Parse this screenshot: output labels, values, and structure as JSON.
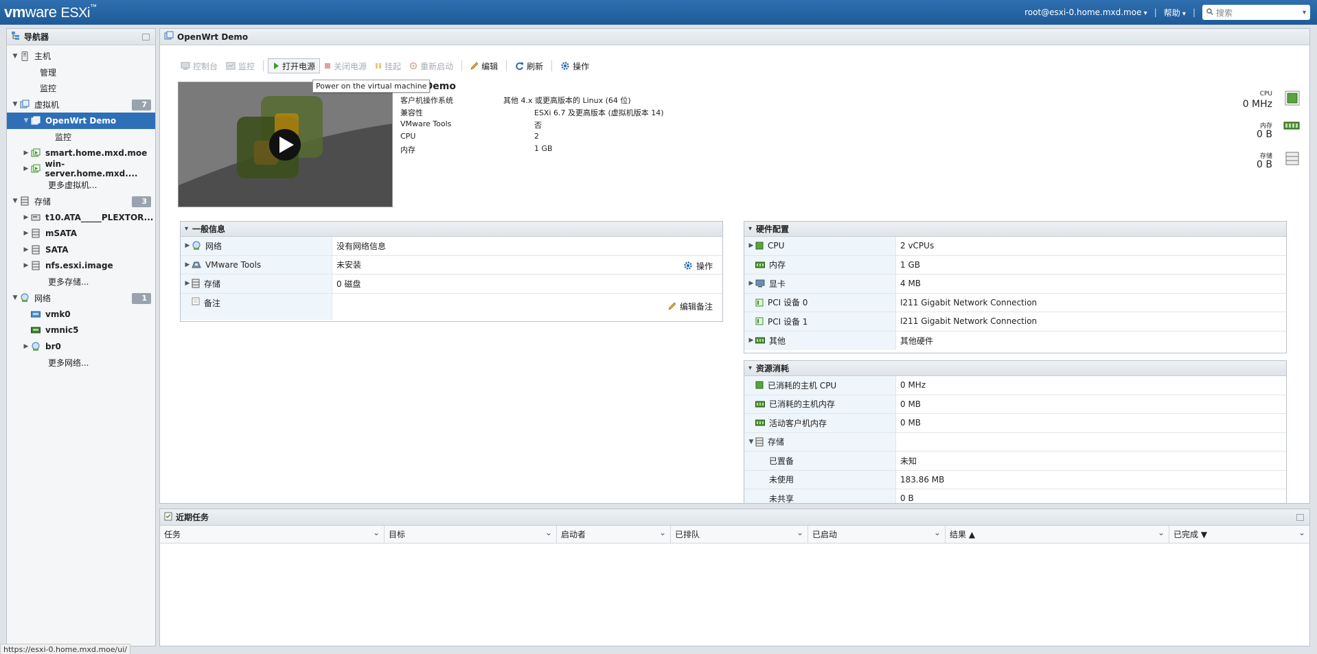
{
  "header": {
    "brand_vm": "vm",
    "brand_ware": "ware",
    "brand_esxi": "ESXi",
    "brand_tm": "™",
    "user": "root@esxi-0.home.mxd.moe",
    "help": "帮助",
    "search_placeholder": "搜索"
  },
  "navigator": {
    "title": "导航器",
    "host": {
      "label": "主机",
      "children": [
        "管理",
        "监控"
      ]
    },
    "vms": {
      "label": "虚拟机",
      "count": "7",
      "selected": "OpenWrt Demo",
      "selected_child": "监控",
      "items": [
        "smart.home.mxd.moe",
        "win-server.home.mxd...."
      ],
      "more": "更多虚拟机..."
    },
    "storage": {
      "label": "存储",
      "count": "3",
      "items": [
        "t10.ATA_____PLEXTOR...",
        "mSATA",
        "SATA",
        "nfs.esxi.image"
      ],
      "more": "更多存储..."
    },
    "network": {
      "label": "网络",
      "count": "1",
      "items": [
        "vmk0",
        "vmnic5",
        "br0"
      ],
      "more": "更多网络..."
    }
  },
  "main": {
    "title": "OpenWrt Demo",
    "toolbar": {
      "console": "控制台",
      "monitor": "监控",
      "power_on": "打开电源",
      "power_off": "关闭电源",
      "suspend": "挂起",
      "restart": "重新启动",
      "edit": "编辑",
      "refresh": "刷新",
      "actions": "操作"
    },
    "tooltip": "Power on the virtual machine",
    "vm_name_visible": "nWrt Demo",
    "props": [
      {
        "k": "客户机操作系统",
        "v": "其他 4.x 或更高版本的 Linux (64 位)"
      },
      {
        "k": "兼容性",
        "v": "ESXi 6.7 及更高版本 (虚拟机版本 14)"
      },
      {
        "k": "VMware Tools",
        "v": "否"
      },
      {
        "k": "CPU",
        "v": "2"
      },
      {
        "k": "内存",
        "v": "1 GB"
      }
    ],
    "stats": {
      "cpu_label": "CPU",
      "cpu_value": "0 MHz",
      "mem_label": "内存",
      "mem_value": "0 B",
      "storage_label": "存储",
      "storage_value": "0 B"
    },
    "general": {
      "title": "一般信息",
      "network_k": "网络",
      "network_v": "没有网络信息",
      "tools_k": "VMware Tools",
      "tools_v": "未安装",
      "tools_action": "操作",
      "storage_k": "存储",
      "storage_v": "0 磁盘",
      "notes_k": "备注",
      "notes_action": "编辑备注"
    },
    "hardware": {
      "title": "硬件配置",
      "rows": [
        {
          "k": "CPU",
          "v": "2 vCPUs"
        },
        {
          "k": "内存",
          "v": "1 GB"
        },
        {
          "k": "显卡",
          "v": "4 MB"
        },
        {
          "k": "PCI 设备 0",
          "v": "I211 Gigabit Network Connection"
        },
        {
          "k": "PCI 设备 1",
          "v": "I211 Gigabit Network Connection"
        },
        {
          "k": "其他",
          "v": "其他硬件"
        }
      ]
    },
    "resources": {
      "title": "资源消耗",
      "rows": [
        {
          "k": "已消耗的主机 CPU",
          "v": "0 MHz"
        },
        {
          "k": "已消耗的主机内存",
          "v": "0 MB"
        },
        {
          "k": "活动客户机内存",
          "v": "0 MB"
        },
        {
          "k": "存储",
          "v": ""
        },
        {
          "k": "已置备",
          "v": "未知"
        },
        {
          "k": "未使用",
          "v": "183.86 MB"
        },
        {
          "k": "未共享",
          "v": "0 B"
        }
      ]
    }
  },
  "tasks": {
    "title": "近期任务",
    "columns": [
      "任务",
      "目标",
      "启动者",
      "已排队",
      "已启动",
      "结果 ▲",
      "已完成 ▼"
    ]
  },
  "status_url": "https://esxi-0.home.mxd.moe/ui/"
}
